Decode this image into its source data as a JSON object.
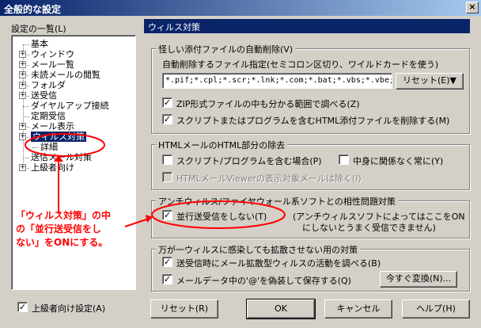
{
  "window": {
    "title": "全般的な設定",
    "close_glyph": "×"
  },
  "sidebar": {
    "title": "設定の一覧(L)",
    "items": [
      {
        "label": "基本",
        "expandable": false
      },
      {
        "label": "ウィンドウ",
        "expandable": true
      },
      {
        "label": "メール一覧",
        "expandable": true
      },
      {
        "label": "未読メールの閲覧",
        "expandable": true
      },
      {
        "label": "フォルダ",
        "expandable": true
      },
      {
        "label": "送受信",
        "expandable": true
      },
      {
        "label": "ダイヤルアップ接続",
        "expandable": false
      },
      {
        "label": "定期受信",
        "expandable": false
      },
      {
        "label": "メール表示",
        "expandable": true
      },
      {
        "label": "ウィルス対策",
        "expandable": true,
        "selected": true
      },
      {
        "label": "詳細",
        "expandable": false,
        "child": true
      },
      {
        "label": "送信メール対策",
        "expandable": false
      },
      {
        "label": "上級者向け",
        "expandable": true
      }
    ],
    "advanced_checkbox": {
      "label": "上級者向け設定(A)",
      "checked": true
    }
  },
  "panel": {
    "header": "ウィルス対策",
    "group1": {
      "title": "怪しい添付ファイルの自動削除(V)",
      "filename_label": "自動削除するファイル指定(セミコロン区切り、ワイルドカードを使う)",
      "filename_value": "*.pif;*.cpl;*.scr;*.lnk;*.com;*.bat;*.vbs;*.vbe;",
      "reset_button": "リセット(E)▼",
      "zip_checkbox": {
        "label": "ZIP形式ファイルの中も分かる範囲で調べる(Z)",
        "checked": true
      },
      "script_checkbox": {
        "label": "スクリプトまたはプログラムを含むHTML添付ファイルを削除する(M)",
        "checked": true
      }
    },
    "group2": {
      "title": "HTMLメールのHTML部分の除去",
      "script_checkbox": {
        "label": "スクリプト/プログラムを含む場合(P)",
        "checked": false
      },
      "always_checkbox": {
        "label": "中身に関係なく常に(Y)",
        "checked": false
      },
      "viewer_checkbox": {
        "label": "HTMLメールViewerの表示対象メールは除く(I)",
        "checked": false
      }
    },
    "group3": {
      "title": "アンチウィルス/ファイヤウォール系ソフトとの相性問題対策",
      "parallel_checkbox": {
        "label": "並行送受信をしない(T)",
        "checked": true
      },
      "note_line1": "(アンチウィルスソフトによってはここをON",
      "note_line2": "にしないとうまく受信できません)"
    },
    "group4": {
      "title": "万が一ウィルスに感染しても拡散させない用の対策",
      "send_checkbox": {
        "label": "送受信時にメール拡散型ウィルスの活動を調べる(B)",
        "checked": true
      },
      "disguise_checkbox": {
        "label": "メールデータ中の'@'を偽装して保存する(Q)",
        "checked": true
      },
      "convert_button": "今すぐ変換(N)..."
    }
  },
  "footer": {
    "reset_button": "リセット(R)",
    "ok_button": "OK",
    "cancel_button": "キャンセル",
    "help_button": "ヘルプ(H)"
  },
  "annotation": {
    "line1": "「ウィルス対策」の中",
    "line2": "の「並行送受信をし",
    "line3": "ない」をONにする。"
  },
  "colors": {
    "dialog_bg": "#d4d0c8",
    "titlebar": "#0a246a",
    "selection": "#0a246a",
    "annotation": "#ff0000"
  }
}
